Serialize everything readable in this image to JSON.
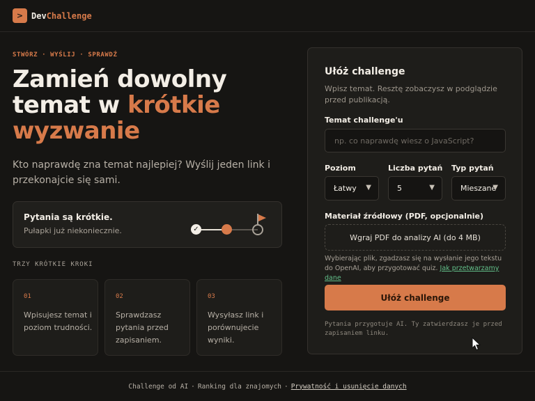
{
  "header": {
    "logo_icon": ">",
    "logo_part1": "Dev",
    "logo_part2": "Challenge"
  },
  "hero": {
    "eyebrow": "STWÓRZ · WYŚLIJ · SPRAWDŹ",
    "title_line1": "Zamień dowolny",
    "title_line2_a": "temat w ",
    "title_line2_b": "krótkie",
    "title_line3": "wyzwanie",
    "subtitle": "Kto naprawdę zna temat najlepiej? Wyślij jeden link i przekonajcie się sami."
  },
  "info_card": {
    "title": "Pytania są krótkie.",
    "subtitle": "Pułapki już niekoniecznie.",
    "check_icon": "✓"
  },
  "steps": {
    "label": "TRZY KRÓTKIE KROKI",
    "items": [
      {
        "num": "01",
        "text": "Wpisujesz temat i poziom trudności."
      },
      {
        "num": "02",
        "text": "Sprawdzasz pytania przed zapisaniem."
      },
      {
        "num": "03",
        "text": "Wysyłasz link i porównujecie wyniki."
      }
    ]
  },
  "form": {
    "title": "Ułóż challenge",
    "subtitle": "Wpisz temat. Resztę zobaczysz w podglądzie przed publikacją.",
    "topic_label": "Temat challenge'u",
    "topic_placeholder": "np. co naprawdę wiesz o JavaScript?",
    "topic_value": "",
    "level_label": "Poziom",
    "level_value": "Łatwy",
    "count_label": "Liczba pytań",
    "count_value": "5",
    "type_label": "Typ pytań",
    "type_value": "Mieszane",
    "caret": "▼",
    "source_label": "Materiał źródłowy (PDF, opcjonalnie)",
    "upload_label": "Wgraj PDF do analizy AI (do 4 MB)",
    "note_text": "Wybierając plik, zgadzasz się na wysłanie jego tekstu do OpenAI, aby przygotować quiz. ",
    "note_link": "Jak przetwarzamy dane",
    "submit_label": "Ułóż challenge",
    "foot_note": "Pytania przygotuje AI. Ty zatwierdzasz je przed zapisaniem linku."
  },
  "footer": {
    "item1": "Challenge od AI",
    "sep": "·",
    "item2": "Ranking dla znajomych",
    "link": "Prywatność i usunięcie danych"
  },
  "colors": {
    "accent": "#d77a4a",
    "background": "#161513",
    "link_green": "#63c08a"
  }
}
